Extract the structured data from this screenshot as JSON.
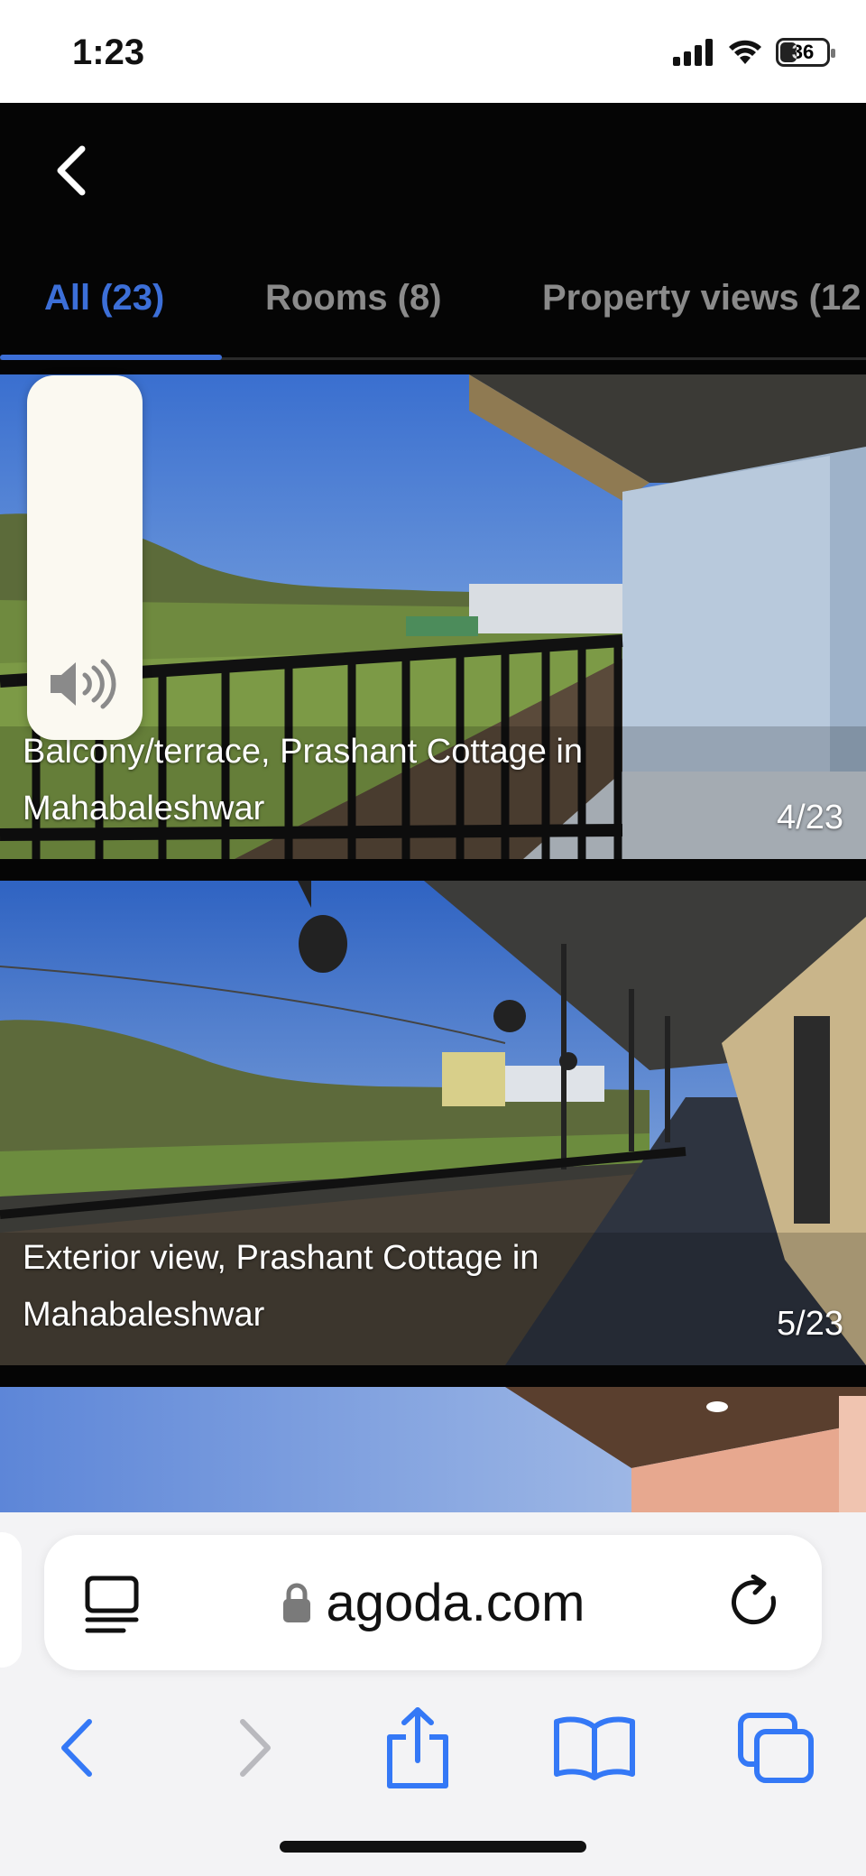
{
  "status_bar": {
    "time": "1:23",
    "battery": "36"
  },
  "gallery": {
    "tabs": [
      {
        "label": "All (23)",
        "selected": true
      },
      {
        "label": "Rooms (8)",
        "selected": false
      },
      {
        "label": "Property views (12",
        "selected": false
      }
    ],
    "photos": [
      {
        "caption": "Balcony/terrace, Prashant Cottage in Mahabaleshwar",
        "counter": "4/23"
      },
      {
        "caption": "Exterior view, Prashant Cottage in Mahabaleshwar",
        "counter": "5/23"
      }
    ]
  },
  "browser": {
    "address": "agoda.com",
    "icons": [
      "reader-mode-icon",
      "lock-icon",
      "reload-icon",
      "back-icon",
      "forward-icon",
      "share-icon",
      "bookmarks-icon",
      "tabs-icon"
    ]
  },
  "colors": {
    "accent": "#3c6fd8",
    "gallery_bg": "#050505",
    "toolbar_blue": "#3478f6"
  }
}
